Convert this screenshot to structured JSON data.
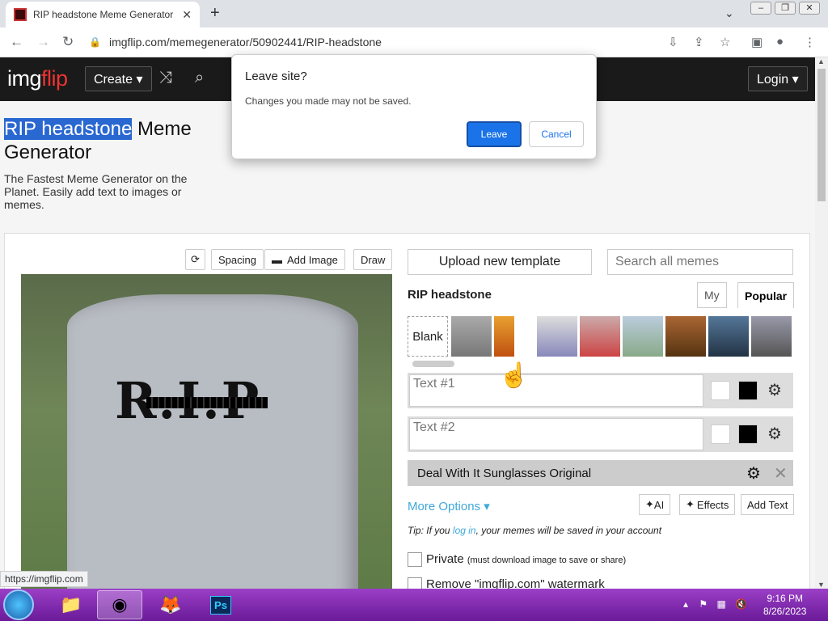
{
  "browser": {
    "tab_title": "RIP headstone Meme Generator",
    "url": "imgflip.com/memegenerator/50902441/RIP-headstone",
    "status_url": "https://imgflip.com"
  },
  "nav": {
    "logo_a": "img",
    "logo_b": "flip",
    "create": "Create ▾",
    "login": "Login ▾"
  },
  "page": {
    "title_sel": "RIP headstone",
    "title_rest": " Meme Generator",
    "subtitle": "The Fastest Meme Generator on the Planet. Easily add text to images or memes."
  },
  "toolbar": {
    "spacing": "Spacing",
    "add_image": "Add Image",
    "draw": "Draw"
  },
  "meme": {
    "rip_text": "R.I.P"
  },
  "right": {
    "upload": "Upload new template",
    "search_placeholder": "Search all memes",
    "template_name": "RIP headstone",
    "tab_my": "My",
    "tab_popular": "Popular",
    "blank": "Blank",
    "text1": "Text #1",
    "text2": "Text #2",
    "deal": "Deal With It Sunglasses Original",
    "more_options": "More Options ▾",
    "ai": "AI",
    "effects": "Effects",
    "add_text": "Add Text",
    "tip_pre": "Tip: If you ",
    "tip_link": "log in",
    "tip_post": ", your memes will be saved in your account",
    "private": "Private",
    "private_note": "(must download image to save or share)",
    "watermark": "Remove \"imgflip.com\" watermark"
  },
  "dialog": {
    "title": "Leave site?",
    "message": "Changes you made may not be saved.",
    "leave": "Leave",
    "cancel": "Cancel"
  },
  "taskbar": {
    "time": "9:16 PM",
    "date": "8/26/2023"
  },
  "colors": {
    "accent": "#1a73e8",
    "link": "#3fa8d8",
    "navbar": "#1a1a1a",
    "taskbar": "#7b2aab"
  }
}
